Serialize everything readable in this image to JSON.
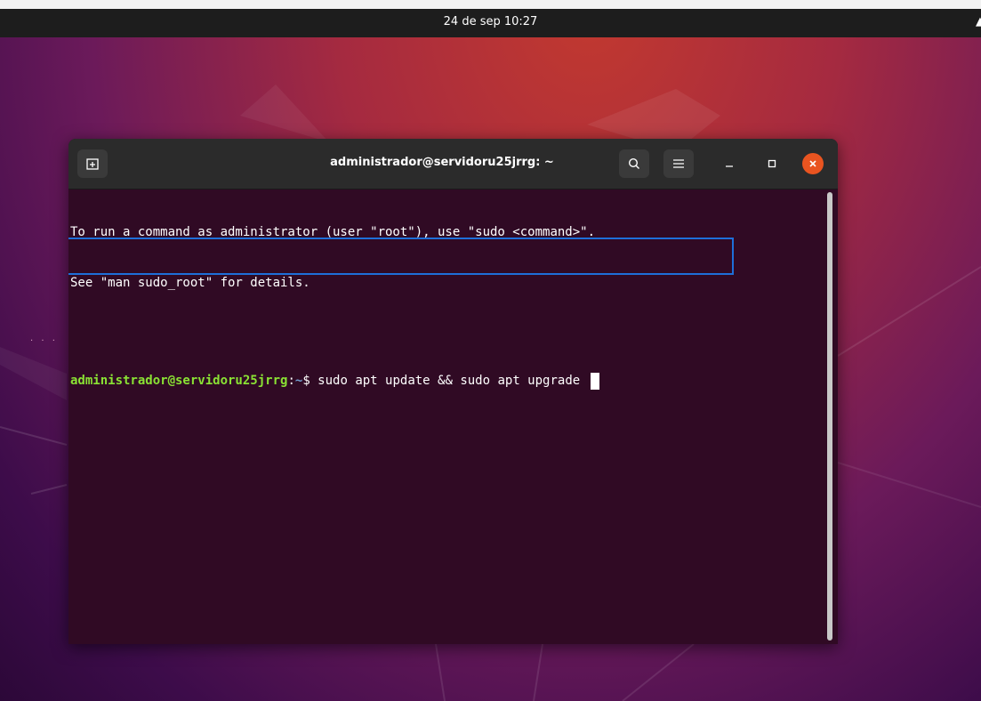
{
  "top_bar": {
    "clock": "24 de sep  10:27"
  },
  "window": {
    "title": "administrador@servidoru25jrrg: ~",
    "buttons": {
      "new_tab_icon": "new-tab-icon",
      "search_icon": "search-icon",
      "menu_icon": "hamburger-menu-icon",
      "minimize_icon": "minimize-icon",
      "maximize_icon": "maximize-icon",
      "close_icon": "close-icon"
    },
    "accent_close": "#e95420"
  },
  "terminal": {
    "lines": [
      "To run a command as administrator (user \"root\"), use \"sudo <command>\".",
      "See \"man sudo_root\" for details."
    ],
    "prompt": {
      "user_host": "administrador@servidoru25jrrg",
      "separator": ":",
      "path": "~",
      "symbol": "$ ",
      "command": "sudo apt update && sudo apt upgrade "
    },
    "colors": {
      "background": "#300a24",
      "user_host": "#8ae234",
      "path": "#729fcf",
      "highlight_box": "#1e6fd9"
    }
  }
}
